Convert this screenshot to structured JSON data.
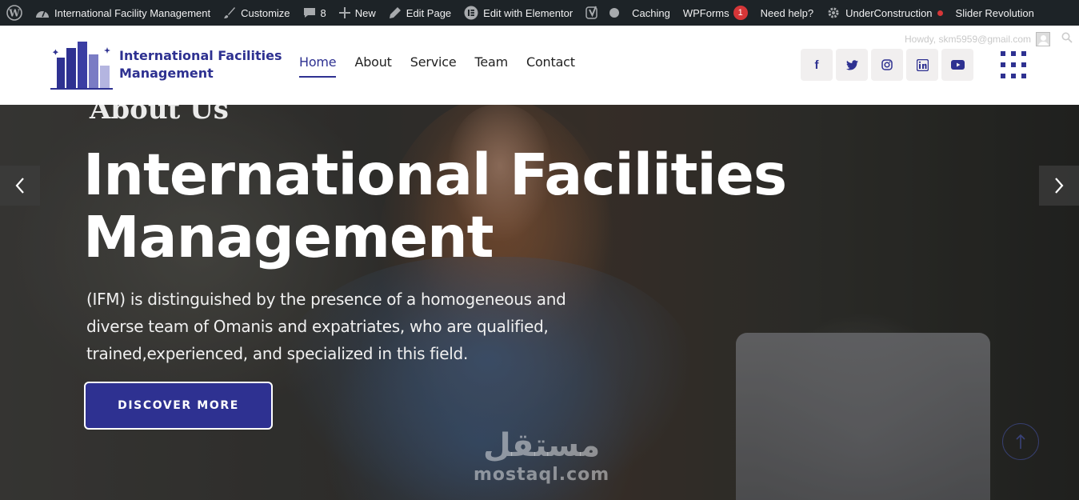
{
  "admin_bar": {
    "site_name": "International Facility Management",
    "customize": "Customize",
    "comments_count": "8",
    "new": "New",
    "edit_page": "Edit Page",
    "edit_elementor": "Edit with Elementor",
    "caching": "Caching",
    "wpforms": "WPForms",
    "wpforms_badge": "1",
    "need_help": "Need help?",
    "under_construction": "UnderConstruction",
    "slider_revolution": "Slider Revolution"
  },
  "header": {
    "logo_line1": "International Facilities",
    "logo_line2": "Management",
    "howdy": "Howdy, skm5959@gmail.com",
    "nav": [
      {
        "label": "Home",
        "active": true
      },
      {
        "label": "About"
      },
      {
        "label": "Service"
      },
      {
        "label": "Team"
      },
      {
        "label": "Contact"
      }
    ],
    "socials": [
      {
        "icon": "facebook-icon",
        "glyph": "f"
      },
      {
        "icon": "twitter-icon"
      },
      {
        "icon": "instagram-icon"
      },
      {
        "icon": "linkedin-icon",
        "glyph": "in"
      },
      {
        "icon": "youtube-icon"
      }
    ]
  },
  "hero": {
    "ghost_title": "About Us",
    "title_line1": "International Facilities",
    "title_line2": "Management",
    "text_line1": "(IFM) is distinguished by the presence of a homogeneous and",
    "text_line2": "diverse team of Omanis and expatriates, who are qualified,",
    "text_line3": "trained,experienced, and specialized in this field.",
    "cta": "DISCOVER MORE"
  },
  "watermark": {
    "arabic": "مستقل",
    "latin": "mostaql.com"
  },
  "colors": {
    "brand": "#2e3191",
    "admin_bar": "#1d2327",
    "badge": "#d63638"
  }
}
